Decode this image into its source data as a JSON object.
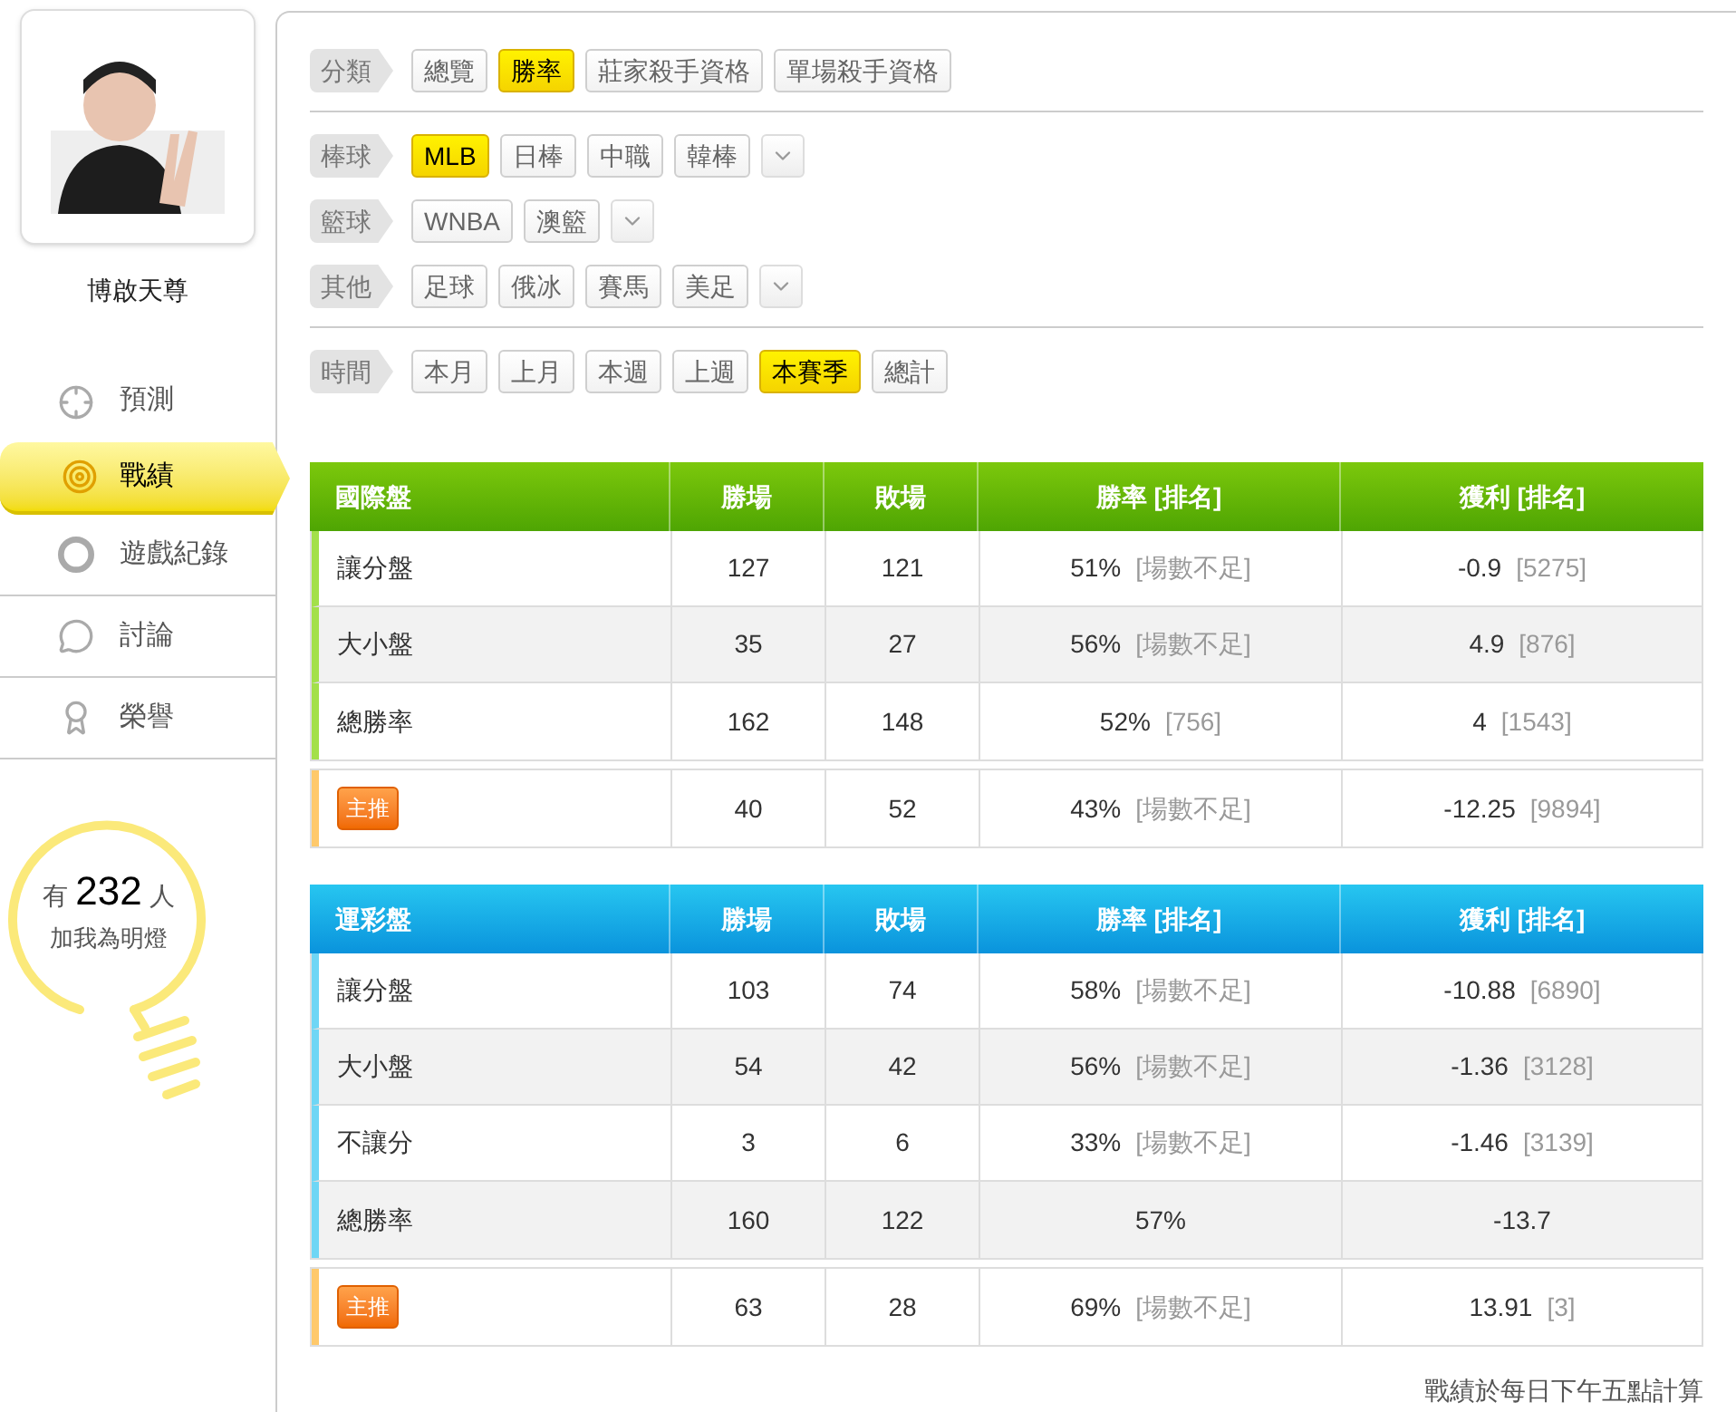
{
  "user": {
    "name": "博啟天尊"
  },
  "nav": [
    {
      "label": "預測",
      "selected": false
    },
    {
      "label": "戰績",
      "selected": true
    },
    {
      "label": "遊戲紀錄",
      "selected": false
    },
    {
      "label": "討論",
      "selected": false
    },
    {
      "label": "榮譽",
      "selected": false
    }
  ],
  "fans": {
    "prefix": "有",
    "count": "232",
    "suffix": "人",
    "caption": "加我為明燈"
  },
  "filter_sections": [
    [
      {
        "label": "分類",
        "more": false,
        "options": [
          {
            "label": "總覽",
            "selected": false
          },
          {
            "label": "勝率",
            "selected": true
          },
          {
            "label": "莊家殺手資格",
            "selected": false
          },
          {
            "label": "單場殺手資格",
            "selected": false
          }
        ]
      }
    ],
    [
      {
        "label": "棒球",
        "more": true,
        "options": [
          {
            "label": "MLB",
            "selected": true
          },
          {
            "label": "日棒",
            "selected": false
          },
          {
            "label": "中職",
            "selected": false
          },
          {
            "label": "韓棒",
            "selected": false
          }
        ]
      },
      {
        "label": "籃球",
        "more": true,
        "options": [
          {
            "label": "WNBA",
            "selected": false
          },
          {
            "label": "澳籃",
            "selected": false
          }
        ]
      },
      {
        "label": "其他",
        "more": true,
        "options": [
          {
            "label": "足球",
            "selected": false
          },
          {
            "label": "俄冰",
            "selected": false
          },
          {
            "label": "賽馬",
            "selected": false
          },
          {
            "label": "美足",
            "selected": false
          }
        ]
      }
    ],
    [
      {
        "label": "時間",
        "more": false,
        "options": [
          {
            "label": "本月",
            "selected": false
          },
          {
            "label": "上月",
            "selected": false
          },
          {
            "label": "本週",
            "selected": false
          },
          {
            "label": "上週",
            "selected": false
          },
          {
            "label": "本賽季",
            "selected": true
          },
          {
            "label": "總計",
            "selected": false
          }
        ]
      }
    ]
  ],
  "tables": [
    {
      "kind": "green",
      "columns": [
        "國際盤",
        "勝場",
        "敗場",
        "勝率 [排名]",
        "獲利 [排名]"
      ],
      "rows": [
        {
          "kind": "normal",
          "label": "讓分盤",
          "wins": "127",
          "losses": "121",
          "rate": "51%",
          "rate_rank": "[場數不足]",
          "profit": "-0.9",
          "profit_rank": "[5275]"
        },
        {
          "kind": "normal",
          "label": "大小盤",
          "wins": "35",
          "losses": "27",
          "rate": "56%",
          "rate_rank": "[場數不足]",
          "profit": "4.9",
          "profit_rank": "[876]"
        },
        {
          "kind": "normal",
          "label": "總勝率",
          "wins": "162",
          "losses": "148",
          "rate": "52%",
          "rate_rank": "[756]",
          "profit": "4",
          "profit_rank": "[1543]"
        },
        {
          "kind": "featured",
          "label": "主推",
          "wins": "40",
          "losses": "52",
          "rate": "43%",
          "rate_rank": "[場數不足]",
          "profit": "-12.25",
          "profit_rank": "[9894]"
        }
      ]
    },
    {
      "kind": "blue",
      "columns": [
        "運彩盤",
        "勝場",
        "敗場",
        "勝率 [排名]",
        "獲利 [排名]"
      ],
      "rows": [
        {
          "kind": "normal",
          "label": "讓分盤",
          "wins": "103",
          "losses": "74",
          "rate": "58%",
          "rate_rank": "[場數不足]",
          "profit": "-10.88",
          "profit_rank": "[6890]"
        },
        {
          "kind": "normal",
          "label": "大小盤",
          "wins": "54",
          "losses": "42",
          "rate": "56%",
          "rate_rank": "[場數不足]",
          "profit": "-1.36",
          "profit_rank": "[3128]"
        },
        {
          "kind": "normal",
          "label": "不讓分",
          "wins": "3",
          "losses": "6",
          "rate": "33%",
          "rate_rank": "[場數不足]",
          "profit": "-1.46",
          "profit_rank": "[3139]"
        },
        {
          "kind": "normal",
          "label": "總勝率",
          "wins": "160",
          "losses": "122",
          "overall_rate": "57%",
          "profit": "-13.7"
        },
        {
          "kind": "featured",
          "label": "主推",
          "wins": "63",
          "losses": "28",
          "rate": "69%",
          "rate_rank": "[場數不足]",
          "profit": "13.91",
          "profit_rank": "[3]"
        }
      ]
    }
  ],
  "footnote": "戰績於每日下午五點計算"
}
